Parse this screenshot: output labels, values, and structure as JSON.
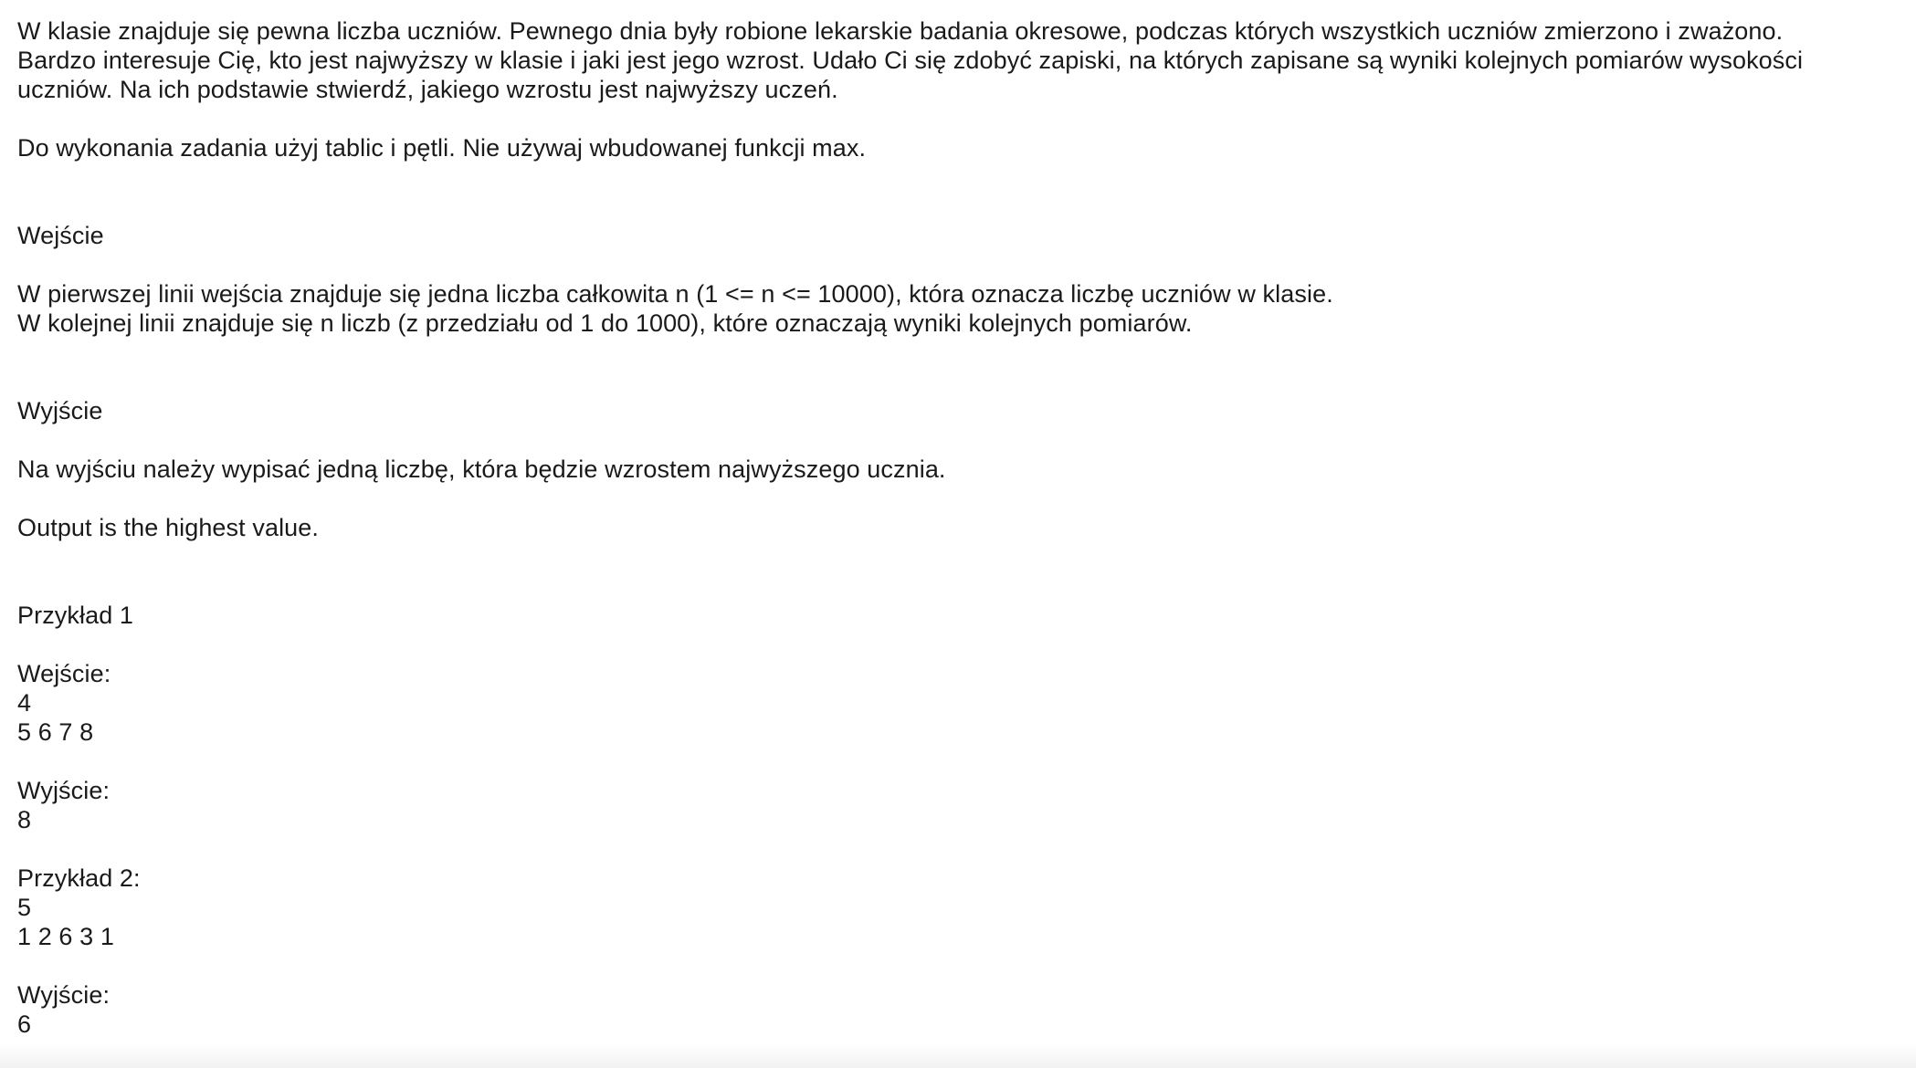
{
  "problem": {
    "intro_lines": [
      "W klasie znajduje się pewna liczba uczniów. Pewnego dnia były robione lekarskie badania okresowe, podczas których wszystkich uczniów zmierzono i zważono.",
      "Bardzo interesuje Cię, kto jest najwyższy w klasie i jaki jest jego wzrost. Udało Ci się zdobyć zapiski, na których zapisane są wyniki kolejnych pomiarów wysokości",
      "uczniów. Na ich podstawie stwierdź, jakiego wzrostu jest najwyższy uczeń."
    ],
    "instruction": "Do wykonania zadania użyj tablic i pętli. Nie używaj wbudowanej funkcji max.",
    "input_heading": "Wejście",
    "input_lines": [
      "W pierwszej linii wejścia znajduje się jedna liczba całkowita n (1 <= n <= 10000), która oznacza liczbę uczniów w klasie.",
      "W kolejnej linii znajduje się n liczb (z przedziału od 1 do 1000), które oznaczają wyniki kolejnych pomiarów."
    ],
    "output_heading": "Wyjście",
    "output_description": "Na wyjściu należy wypisać jedną liczbę, która będzie wzrostem najwyższego ucznia.",
    "output_note": "Output is the highest value.",
    "example1": {
      "title": "Przykład 1",
      "input_label": "Wejście:",
      "input_lines": [
        "4",
        "5 6 7 8"
      ],
      "output_label": "Wyjście:",
      "output_lines": [
        "8"
      ]
    },
    "example2": {
      "title": "Przykład 2:",
      "input_lines": [
        "5",
        "1 2 6 3 1"
      ],
      "output_label": "Wyjście:",
      "output_lines": [
        "6"
      ]
    }
  }
}
